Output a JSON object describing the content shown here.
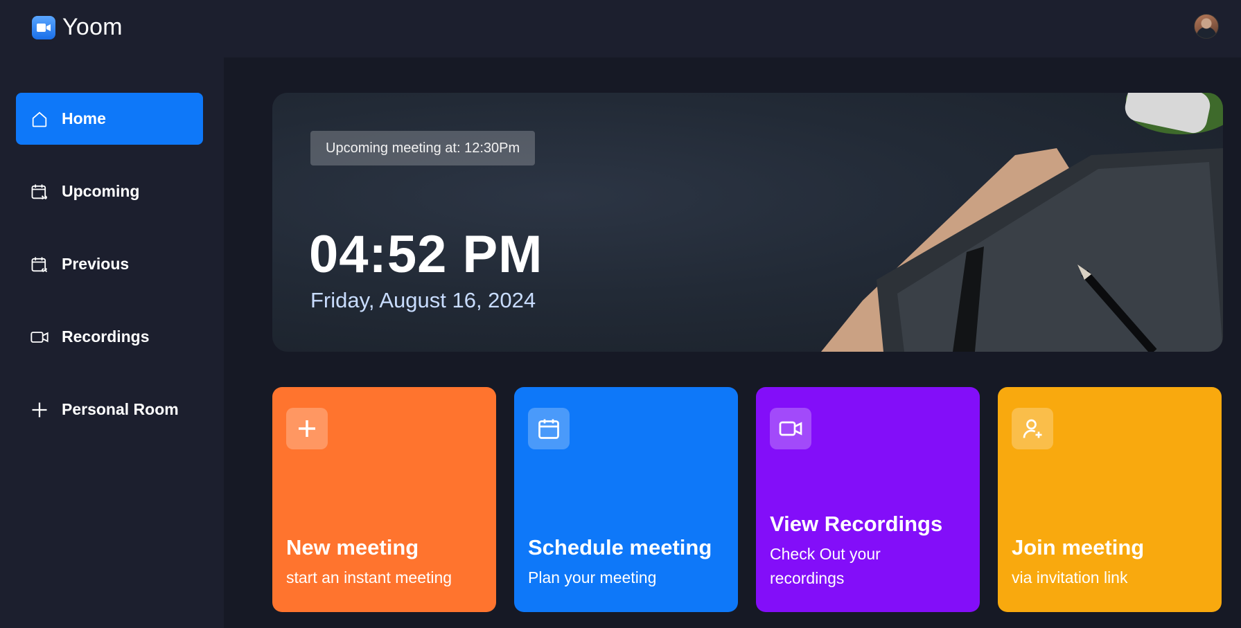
{
  "app": {
    "name": "Yoom"
  },
  "icons": {
    "logo": "video-camera-icon",
    "avatar": "user-avatar"
  },
  "colors": {
    "accent": "#0e78f9",
    "orange": "#ff742e",
    "blue": "#0e78f9",
    "purple": "#830ef9",
    "yellow": "#f9a90e"
  },
  "sidebar": {
    "items": [
      {
        "label": "Home",
        "icon": "home-icon",
        "active": true
      },
      {
        "label": "Upcoming",
        "icon": "calendar-forward-icon"
      },
      {
        "label": "Previous",
        "icon": "calendar-back-icon"
      },
      {
        "label": "Recordings",
        "icon": "video-icon"
      },
      {
        "label": "Personal Room",
        "icon": "plus-icon"
      }
    ]
  },
  "hero": {
    "badge": "Upcoming meeting at: 12:30Pm",
    "time": "04:52 PM",
    "date": "Friday, August 16, 2024"
  },
  "cards": [
    {
      "title": "New meeting",
      "subtitle": "start an instant meeting",
      "icon": "plus-icon",
      "color": "#ff742e"
    },
    {
      "title": "Schedule meeting",
      "subtitle": "Plan your meeting",
      "icon": "calendar-icon",
      "color": "#0e78f9"
    },
    {
      "title": "View Recordings",
      "subtitle": "Check Out your recordings",
      "icon": "video-icon",
      "color": "#830ef9"
    },
    {
      "title": "Join meeting",
      "subtitle": "via invitation link",
      "icon": "add-user-icon",
      "color": "#f9a90e"
    }
  ]
}
